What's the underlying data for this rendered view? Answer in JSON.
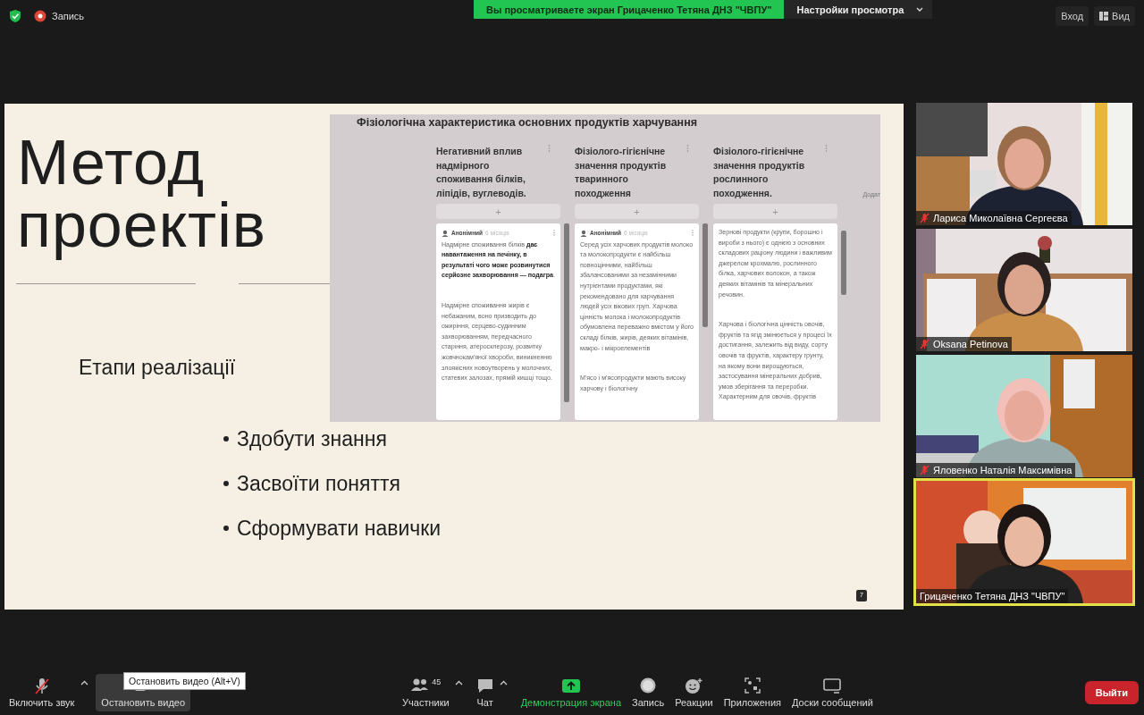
{
  "top_bar": {
    "recording": "Запись",
    "banner": "Вы просматриваете экран Грицаченко Тетяна ДНЗ \"ЧВПУ\"",
    "view_options": "Настройки просмотра",
    "buttons": [
      {
        "label": "Вход",
        "kind": "plain"
      },
      {
        "label": "Вид",
        "kind": "view"
      }
    ]
  },
  "slide": {
    "title": [
      "Метод",
      "проектів"
    ],
    "subtitle": "Етапи реалізації",
    "bullets": [
      "Здобути знання",
      "Засвоїти поняття",
      "Сформувати навички"
    ],
    "page_number": "7",
    "board": {
      "title": "Фізіологічна характеристика основних продуктів харчування",
      "side_text": "Додат",
      "add_label": "+",
      "columns": [
        {
          "heading": "Негативний вплив надмірного споживання білків, ліпідів, вуглеводів.",
          "card": {
            "author": "Анонімний",
            "time": "6 місяців",
            "paragraphs": [
              "Надмірне споживання білків **дає навантаження на печінку, в результаті чого може розвинутися серйозне захворювання — подагра**.",
              "Надмірне споживання жирів є небажаним, воно призводить до ожиріння, серцево-судинним захворюванням, передчасного старіння, атеросклерозу, розвитку жовчнокам'яної хвороби, виникненню злоякісних новоутворень у молочних, статевих залозах, прямій кишці тощо."
            ]
          }
        },
        {
          "heading": "Фізіолого-гігієнічне значення продуктів тваринного походження",
          "card": {
            "author": "Анонімний",
            "time": "6 місяців",
            "paragraphs": [
              "Серед усіх харчових продуктів молоко та молокопродукти є найбільш повноцінними, найбільш збалансованими за незамінними нутрієнтами продуктами, які рекомендовано для харчування людей усіх вікових груп. Харчова цінність молока і молокопродуктів обумовлена переважно вмістом у його складі білків, жирів, деяких вітамінів, макро- і мікроелементів",
              "М'ясо і м'ясопродукти мають високу харчову і біологічну"
            ]
          }
        },
        {
          "heading": "Фізіолого-гігієнічне значення продуктів рослинного походження.",
          "card": {
            "paragraphs": [
              "Зернові продукти (крупи, борошно і вироби з нього) є однією з основних складових раціону людини і важливим джерелом крохмалю, рослинного білка, харчових волокон, а також деяких вітамінів та мінеральних речовин.",
              "Харчова і біологічна цінність овочів, фруктів та ягід змінюється у процесі їх достигання, залежить від виду, сорту овочів та фруктів, характеру грунту, на якому вони вирощуються, застосування мінеральних добрив, умов зберігання та переробки. Характерним для овочів, фруктів"
            ]
          }
        }
      ]
    }
  },
  "participants": [
    {
      "name": "Лариса Миколаївна Сергеєва",
      "muted": true,
      "active": false
    },
    {
      "name": "Oksana Petinova",
      "muted": true,
      "active": false
    },
    {
      "name": "Яловенко Наталія Максимівна",
      "muted": true,
      "active": false
    },
    {
      "name": "Грицаченко Тетяна ДНЗ \"ЧВПУ\"",
      "muted": false,
      "active": true
    }
  ],
  "toolbar": {
    "left": [
      {
        "kind": "mic",
        "label": "Включить звук",
        "caret": true,
        "hovered": false
      },
      {
        "kind": "video",
        "label": "Остановить видео",
        "caret": false,
        "hovered": true
      }
    ],
    "center": [
      {
        "kind": "participants",
        "label": "Участники",
        "count": "45",
        "caret": true,
        "hovered": false
      },
      {
        "kind": "chat",
        "label": "Чат",
        "caret": true,
        "hovered": false
      },
      {
        "kind": "share",
        "label": "Демонстрация экрана",
        "caret": false,
        "hovered": false
      },
      {
        "kind": "record",
        "label": "Запись",
        "caret": false,
        "hovered": false
      },
      {
        "kind": "reactions",
        "label": "Реакции",
        "caret": false,
        "hovered": false
      },
      {
        "kind": "apps",
        "label": "Приложения",
        "caret": false,
        "hovered": false
      },
      {
        "kind": "boards",
        "label": "Доски сообщений",
        "caret": false,
        "hovered": false
      }
    ],
    "leave": "Выйти",
    "tooltip": "Остановить видео (Alt+V)"
  }
}
